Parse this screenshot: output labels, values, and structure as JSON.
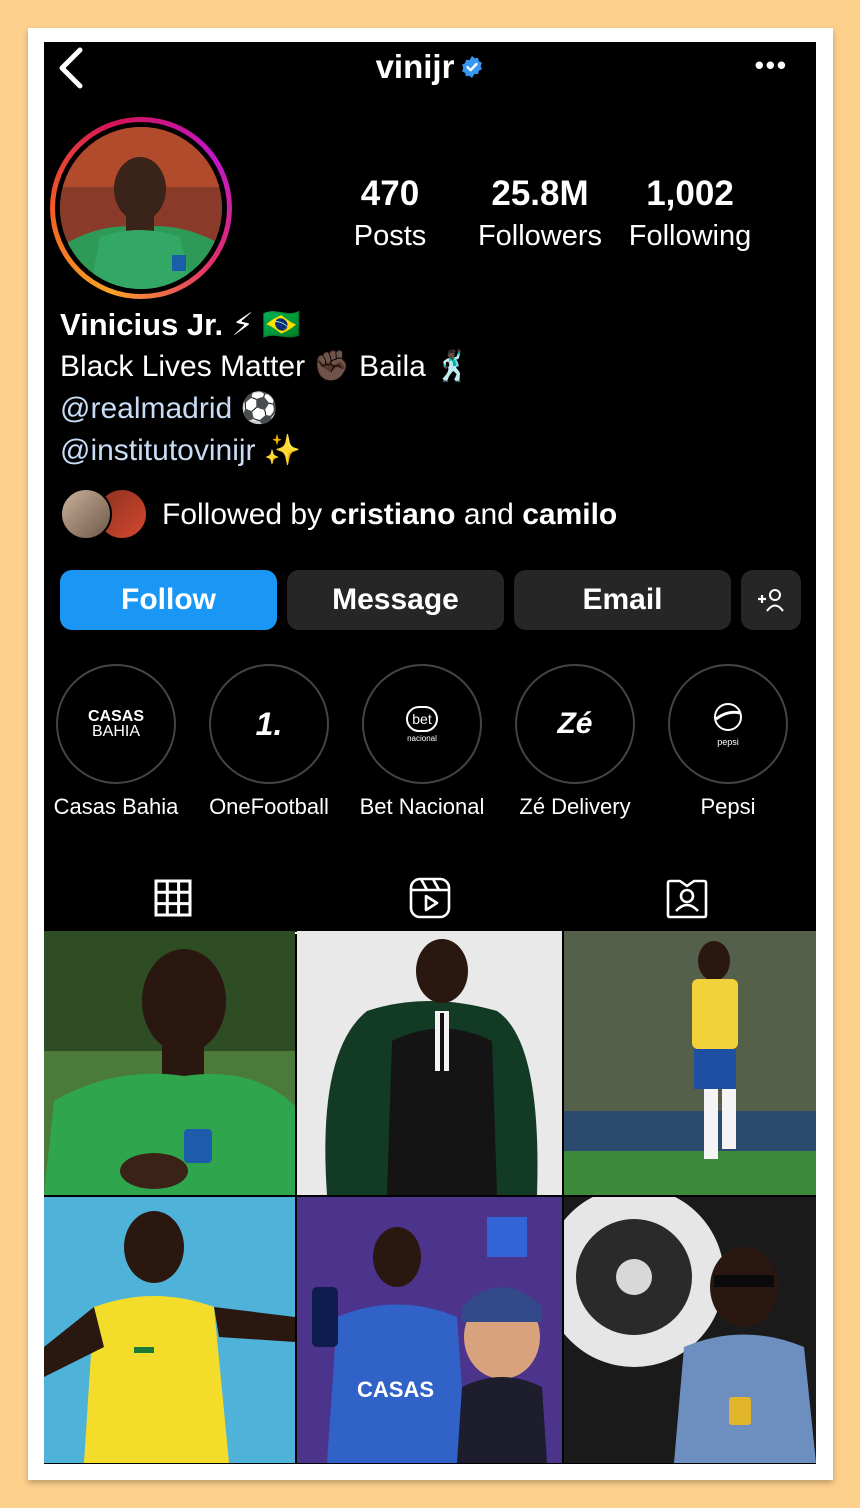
{
  "profile": {
    "username": "vinijr",
    "verified": true,
    "display_name": "Vinicius Jr. ⚡ 🇧🇷",
    "bio_line_1": "Black Lives Matter ✊🏿 Baila 🕺🏿",
    "bio_link_1": "@realmadrid ⚽",
    "bio_link_2": "@institutovinijr ✨"
  },
  "stats": [
    {
      "value": "470",
      "label": "Posts"
    },
    {
      "value": "25.8M",
      "label": "Followers"
    },
    {
      "value": "1,002",
      "label": "Following"
    }
  ],
  "followed_by": {
    "prefix": "Followed by",
    "user_1": "cristiano",
    "joiner": "and",
    "user_2": "camilo"
  },
  "actions": {
    "follow": "Follow",
    "message": "Message",
    "email": "Email",
    "add_user": "+👤"
  },
  "highlights": [
    {
      "label": "Casas Bahia",
      "logo_text_1": "CASAS",
      "logo_text_2": "BAHIA"
    },
    {
      "label": "OneFootball",
      "logo_text_1": "1."
    },
    {
      "label": "Bet Nacional",
      "logo_text_1": "bet",
      "logo_text_2": "nacional"
    },
    {
      "label": "Zé Delivery",
      "logo_text_1": "Zé"
    },
    {
      "label": "Pepsi",
      "logo_text_1": "pepsi"
    }
  ],
  "colors": {
    "accent_blue": "#1a97f5",
    "background": "#000000",
    "button_gray": "#262626",
    "link": "#c8dcf5"
  },
  "tabs": [
    {
      "name": "grid",
      "icon": "grid-icon",
      "active": true
    },
    {
      "name": "reels",
      "icon": "reels-icon",
      "active": false
    },
    {
      "name": "tagged",
      "icon": "tagged-icon",
      "active": false
    }
  ]
}
